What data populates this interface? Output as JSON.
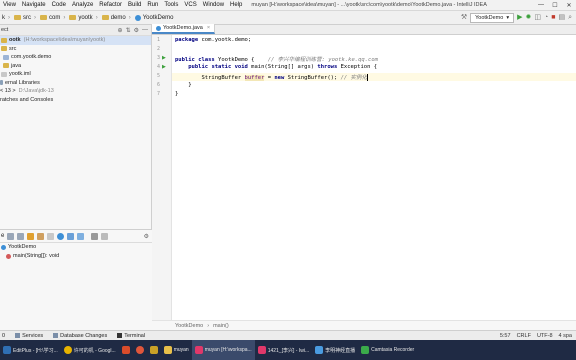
{
  "menubar": {
    "items": [
      "File",
      "Edit",
      "View",
      "Navigate",
      "Code",
      "Analyze",
      "Refactor",
      "Build",
      "Run",
      "Tools",
      "VCS",
      "Window",
      "Help"
    ],
    "visible_items": [
      "",
      "View",
      "Navigate",
      "Code",
      "Analyze",
      "Refactor",
      "Build",
      "Run",
      "Tools",
      "VCS",
      "Window",
      "Help"
    ],
    "title": "muyan [H:\\workspace\\idea\\muyan] - ...\\yootk\\src\\com\\yootk\\demo\\YootkDemo.java - IntelliJ IDEA",
    "minimize": "—",
    "maximize": "☐",
    "close": "✕"
  },
  "navbar": {
    "crumbs": [
      "k",
      "src",
      "com",
      "yootk",
      "demo",
      "YootkDemo"
    ],
    "run_config": "YootkDemo"
  },
  "project": {
    "header": "ect",
    "rows": [
      {
        "text": "ootk",
        "path": "(H:\\workspace\\idea\\muyan\\yootk)",
        "icon": "folder",
        "selected": true
      },
      {
        "text": "src",
        "path": "",
        "icon": "folder",
        "selected": false
      },
      {
        "text": "com.yootk.demo",
        "path": "",
        "icon": "pkg",
        "selected": false
      },
      {
        "text": "java",
        "path": "",
        "icon": "folder",
        "selected": false
      },
      {
        "text": "yootk.iml",
        "path": "",
        "icon": "iml",
        "selected": false
      },
      {
        "text": "ernal Libraries",
        "path": "",
        "icon": "lib",
        "selected": false
      },
      {
        "text": "< 13 >",
        "path": "D:\\Java\\jdk-13",
        "icon": "lib",
        "selected": false
      },
      {
        "text": "ratches and Consoles",
        "path": "",
        "icon": "lib",
        "selected": false
      }
    ]
  },
  "structure": {
    "header": "e",
    "class_name": "YootkDemo",
    "method": "main(String[]): void"
  },
  "editor": {
    "tab": "YootkDemo.java",
    "tab_close": "×",
    "line_numbers": [
      "1",
      "2",
      "3",
      "4",
      "5",
      "6",
      "7"
    ],
    "lines": {
      "l1_kw": "package",
      "l1_rest": " com.yootk.demo;",
      "l3_kw1": "public",
      "l3_kw2": "class",
      "l3_rest": " YootkDemo {",
      "l3_comment": "// 李兴华编程训练营: yootk.ke.qq.com",
      "l4_kw1": "public",
      "l4_kw2": "static",
      "l4_kw3": "void",
      "l4_rest": " main(String[] args) ",
      "l4_kw4": "throws",
      "l4_rest2": " Exception {",
      "l5_pre": "StringBuffer ",
      "l5_var": "buffer",
      "l5_mid": " = ",
      "l5_kw": "new",
      "l5_rest": " StringBuffer(); ",
      "l5_comment": "// 实例化",
      "l6": "}",
      "l7": "}"
    },
    "breadcrumb": [
      "YootkDemo",
      "main()"
    ]
  },
  "bottom": {
    "tabs": [
      "0",
      "Services",
      "Database Changes",
      "Terminal"
    ],
    "status": [
      "5:57",
      "CRLF",
      "UTF-8",
      "4 spa"
    ]
  },
  "taskbar": {
    "items": [
      "EditPlus - [H:\\学习...",
      "许可的机 - Googl...",
      "",
      "",
      "",
      "muyan",
      "muyan [H:\\workspa...",
      "1421_[李兴] - Iwi...",
      "李明神经直播",
      "Camtasia Recorder"
    ]
  },
  "colors": {
    "keyword": "#000080",
    "comment": "#808080",
    "run_green": "#3ca03c",
    "selection": "#d5e2f5",
    "taskbar": "#1f2a44"
  }
}
